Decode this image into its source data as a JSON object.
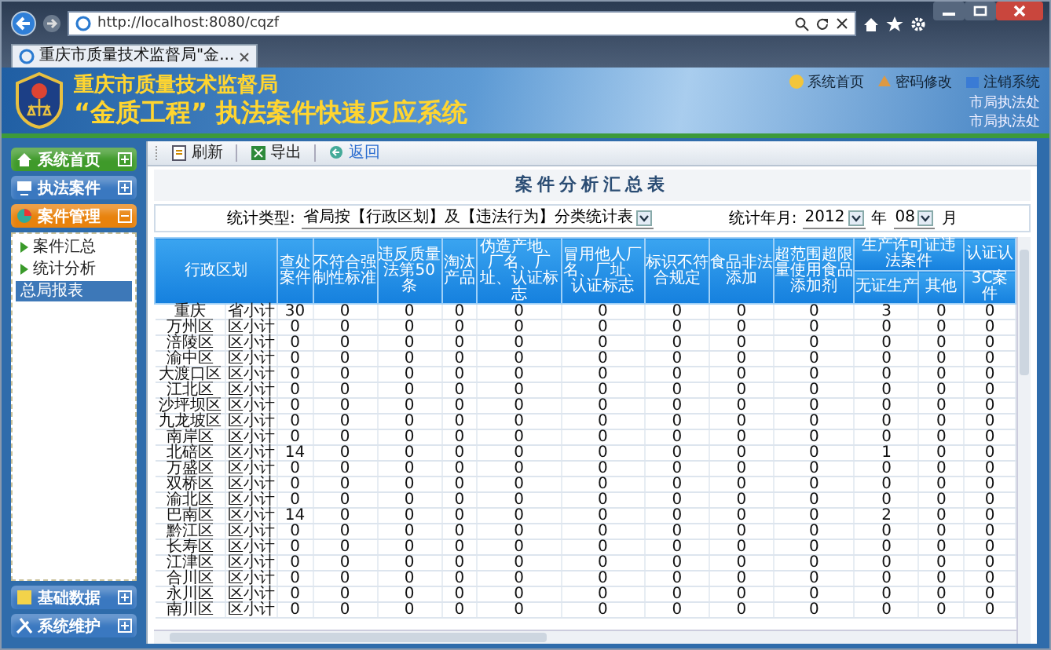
{
  "browser": {
    "url": "http://localhost:8080/cqzf",
    "tab_title": "重庆市质量技术监督局\"金..."
  },
  "banner": {
    "org": "重庆市质量技术监督局",
    "system": "“金质工程” 执法案件快速反应系统",
    "links": [
      {
        "label": "系统首页"
      },
      {
        "label": "密码修改"
      },
      {
        "label": "注销系统"
      }
    ],
    "user_lines": [
      "市局执法处",
      "市局执法处"
    ]
  },
  "sidebar": {
    "sections": [
      {
        "label": "系统首页",
        "color": "#3f9a2a",
        "expanded": false
      },
      {
        "label": "执法案件",
        "color": "#3a78c0",
        "expanded": false
      },
      {
        "label": "案件管理",
        "color": "#e8820c",
        "expanded": true,
        "items": [
          {
            "label": "案件汇总",
            "selected": false
          },
          {
            "label": "统计分析",
            "selected": false
          },
          {
            "label": "总局报表",
            "selected": true
          }
        ]
      },
      {
        "label": "基础数据",
        "color": "#3a78c0",
        "expanded": false
      },
      {
        "label": "系统维护",
        "color": "#3a78c0",
        "expanded": false
      }
    ]
  },
  "toolbar": [
    {
      "label": "刷新",
      "kind": "refresh"
    },
    {
      "label": "导出",
      "kind": "export"
    },
    {
      "label": "返回",
      "kind": "back"
    }
  ],
  "report": {
    "title": "案件分析汇总表",
    "filters": {
      "type_label": "统计类型:",
      "type_value": "省局按【行政区划】及【违法行为】分类统计表",
      "period_label": "统计年月:",
      "year": "2012",
      "year_unit": "年",
      "month": "08",
      "month_unit": "月"
    },
    "columns": [
      {
        "label": "行政区划"
      },
      {
        "label": "查处案件"
      },
      {
        "label": "不符合强制性标准"
      },
      {
        "label": "违反质量法第50条"
      },
      {
        "label": "淘汰产品"
      },
      {
        "label": "伪造产地、厂名、厂址、认证标志"
      },
      {
        "label": "冒用他人厂名、厂址、认证标志"
      },
      {
        "label": "标识不符合规定"
      },
      {
        "label": "食品非法添加"
      },
      {
        "label": "超范围超限量使用食品添加剂"
      },
      {
        "label": "生产许可证违法案件",
        "children": [
          {
            "label": "无证生产"
          },
          {
            "label": "其他"
          }
        ]
      },
      {
        "label": "认证认",
        "children": [
          {
            "label": "3C案件"
          }
        ]
      }
    ],
    "rows": [
      {
        "region": "重庆",
        "level": "省小计",
        "values": [
          "30",
          "0",
          "0",
          "0",
          "0",
          "0",
          "0",
          "0",
          "0",
          "3",
          "0",
          "0"
        ]
      },
      {
        "region": "万州区",
        "level": "区小计",
        "values": [
          "0",
          "0",
          "0",
          "0",
          "0",
          "0",
          "0",
          "0",
          "0",
          "0",
          "0",
          "0"
        ]
      },
      {
        "region": "涪陵区",
        "level": "区小计",
        "values": [
          "0",
          "0",
          "0",
          "0",
          "0",
          "0",
          "0",
          "0",
          "0",
          "0",
          "0",
          "0"
        ]
      },
      {
        "region": "渝中区",
        "level": "区小计",
        "values": [
          "0",
          "0",
          "0",
          "0",
          "0",
          "0",
          "0",
          "0",
          "0",
          "0",
          "0",
          "0"
        ]
      },
      {
        "region": "大渡口区",
        "level": "区小计",
        "values": [
          "0",
          "0",
          "0",
          "0",
          "0",
          "0",
          "0",
          "0",
          "0",
          "0",
          "0",
          "0"
        ]
      },
      {
        "region": "江北区",
        "level": "区小计",
        "values": [
          "0",
          "0",
          "0",
          "0",
          "0",
          "0",
          "0",
          "0",
          "0",
          "0",
          "0",
          "0"
        ]
      },
      {
        "region": "沙坪坝区",
        "level": "区小计",
        "values": [
          "0",
          "0",
          "0",
          "0",
          "0",
          "0",
          "0",
          "0",
          "0",
          "0",
          "0",
          "0"
        ]
      },
      {
        "region": "九龙坡区",
        "level": "区小计",
        "values": [
          "0",
          "0",
          "0",
          "0",
          "0",
          "0",
          "0",
          "0",
          "0",
          "0",
          "0",
          "0"
        ]
      },
      {
        "region": "南岸区",
        "level": "区小计",
        "values": [
          "0",
          "0",
          "0",
          "0",
          "0",
          "0",
          "0",
          "0",
          "0",
          "0",
          "0",
          "0"
        ]
      },
      {
        "region": "北碚区",
        "level": "区小计",
        "values": [
          "14",
          "0",
          "0",
          "0",
          "0",
          "0",
          "0",
          "0",
          "0",
          "1",
          "0",
          "0"
        ]
      },
      {
        "region": "万盛区",
        "level": "区小计",
        "values": [
          "0",
          "0",
          "0",
          "0",
          "0",
          "0",
          "0",
          "0",
          "0",
          "0",
          "0",
          "0"
        ]
      },
      {
        "region": "双桥区",
        "level": "区小计",
        "values": [
          "0",
          "0",
          "0",
          "0",
          "0",
          "0",
          "0",
          "0",
          "0",
          "0",
          "0",
          "0"
        ]
      },
      {
        "region": "渝北区",
        "level": "区小计",
        "values": [
          "0",
          "0",
          "0",
          "0",
          "0",
          "0",
          "0",
          "0",
          "0",
          "0",
          "0",
          "0"
        ]
      },
      {
        "region": "巴南区",
        "level": "区小计",
        "values": [
          "14",
          "0",
          "0",
          "0",
          "0",
          "0",
          "0",
          "0",
          "0",
          "2",
          "0",
          "0"
        ]
      },
      {
        "region": "黔江区",
        "level": "区小计",
        "values": [
          "0",
          "0",
          "0",
          "0",
          "0",
          "0",
          "0",
          "0",
          "0",
          "0",
          "0",
          "0"
        ]
      },
      {
        "region": "长寿区",
        "level": "区小计",
        "values": [
          "0",
          "0",
          "0",
          "0",
          "0",
          "0",
          "0",
          "0",
          "0",
          "0",
          "0",
          "0"
        ]
      },
      {
        "region": "江津区",
        "level": "区小计",
        "values": [
          "0",
          "0",
          "0",
          "0",
          "0",
          "0",
          "0",
          "0",
          "0",
          "0",
          "0",
          "0"
        ]
      },
      {
        "region": "合川区",
        "level": "区小计",
        "values": [
          "0",
          "0",
          "0",
          "0",
          "0",
          "0",
          "0",
          "0",
          "0",
          "0",
          "0",
          "0"
        ]
      },
      {
        "region": "永川区",
        "level": "区小计",
        "values": [
          "0",
          "0",
          "0",
          "0",
          "0",
          "0",
          "0",
          "0",
          "0",
          "0",
          "0",
          "0"
        ]
      },
      {
        "region": "南川区",
        "level": "区小计",
        "values": [
          "0",
          "0",
          "0",
          "0",
          "0",
          "0",
          "0",
          "0",
          "0",
          "0",
          "0",
          "0"
        ]
      }
    ]
  }
}
